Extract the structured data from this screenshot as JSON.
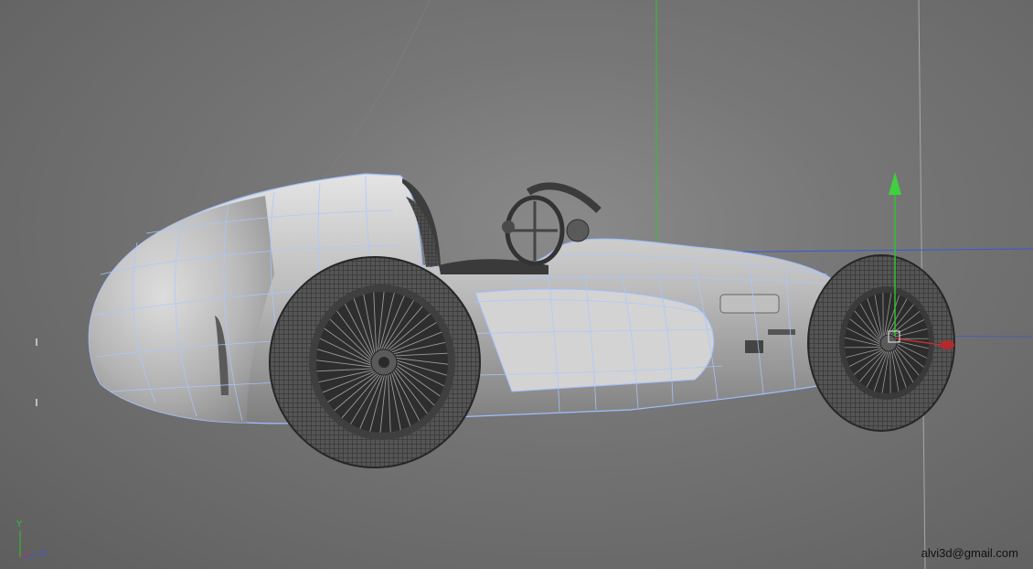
{
  "viewport": {
    "watermark": "alvi3d@gmail.com",
    "axis_indicator": {
      "y_label": "Y",
      "z_label": "Z"
    },
    "colors": {
      "background": "#777777",
      "wireframe": "#a9c8ff",
      "axis_y": "#22c522",
      "axis_x": "#e03030",
      "axis_z": "#3a58d6",
      "body": "#c9c9c9",
      "tire": "#3a3a3a"
    },
    "objects": [
      {
        "name": "race-car-body"
      },
      {
        "name": "rear-wheel"
      },
      {
        "name": "front-wheel"
      },
      {
        "name": "steering-wheel"
      },
      {
        "name": "move-gizmo"
      }
    ]
  }
}
